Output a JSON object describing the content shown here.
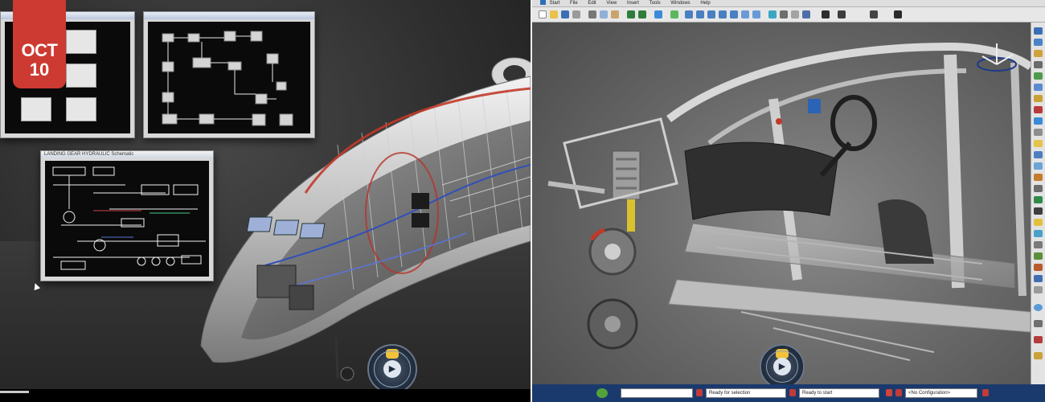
{
  "badge": {
    "month": "OCT",
    "day": "10"
  },
  "left": {
    "windows": {
      "schematic_title": "LANDING GEAR HYDRAULIC Schematic"
    }
  },
  "right": {
    "menus": [
      "Start",
      "File",
      "Edit",
      "View",
      "Insert",
      "Tools",
      "Windows",
      "Help"
    ],
    "status": {
      "command_field": "",
      "hint_left": "Ready for selection",
      "hint_right": "Ready to start",
      "config": "<No Configuration>"
    }
  },
  "colors": {
    "badge": "#cc3a31",
    "statusbar": "#1a3a6e",
    "compass_hub": "#f2c23b"
  }
}
